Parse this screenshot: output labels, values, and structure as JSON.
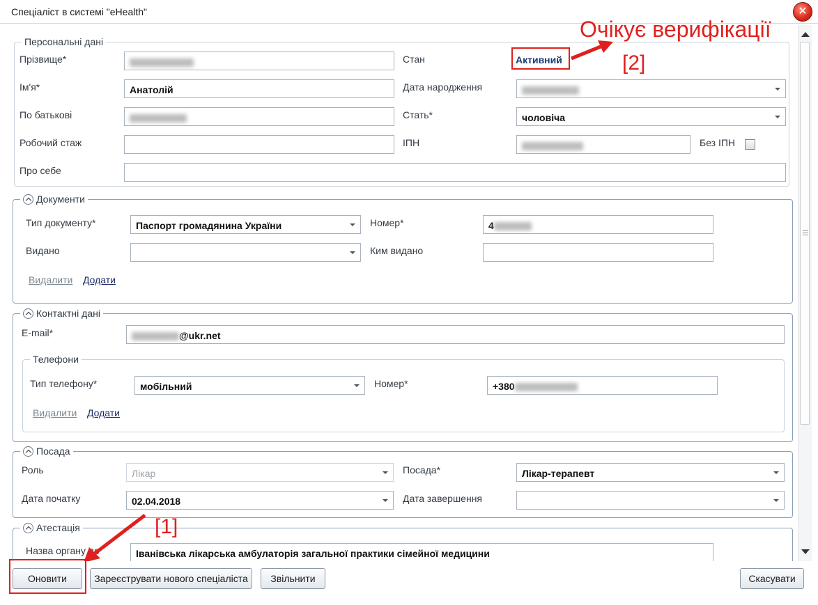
{
  "window": {
    "title": "Спеціаліст в системі \"eHealth\"",
    "close_symbol": "✕"
  },
  "personal": {
    "legend": "Персональні дані",
    "surname_label": "Прізвище*",
    "name_label": "Ім'я*",
    "name_value": "Анатолій",
    "patronymic_label": "По батькові",
    "experience_label": "Робочий стаж",
    "about_label": "Про себе",
    "status_label": "Стан",
    "status_value": "Активний",
    "birthdate_label": "Дата народження",
    "gender_label": "Стать*",
    "gender_value": "чоловіча",
    "ipn_label": "ІПН",
    "no_ipn_label": "Без ІПН"
  },
  "documents": {
    "legend": "Документи",
    "doc_type_label": "Тип документу*",
    "doc_type_value": "Паспорт громадянина України",
    "number_label": "Номер*",
    "number_value": "4",
    "issued_label": "Видано",
    "issued_by_label": "Ким видано",
    "delete_link": "Видалити",
    "add_link": "Додати"
  },
  "contacts": {
    "legend": "Контактні дані",
    "email_label": "E-mail*",
    "email_value": "@ukr.net",
    "phones": {
      "legend": "Телефони",
      "type_label": "Тип телефону*",
      "type_value": "мобільний",
      "number_label": "Номер*",
      "number_value": "+380",
      "delete_link": "Видалити",
      "add_link": "Додати"
    }
  },
  "position": {
    "legend": "Посада",
    "role_label": "Роль",
    "role_value": "Лікар",
    "position_label": "Посада*",
    "position_value": "Лікар-терапевт",
    "start_label": "Дата початку",
    "start_value": "02.04.2018",
    "end_label": "Дата завершення"
  },
  "attestation": {
    "legend": "Атестація",
    "org_label": "Назва органу до",
    "org_value": "Іванівська лікарська амбулаторія загальної практики сімейної медицини"
  },
  "annotations": {
    "awaiting": "Очікує верифікації",
    "marker_2": "[2]",
    "marker_1": "[1]",
    "color": "#e0201e"
  },
  "buttons": {
    "update": "Оновити",
    "register": "Зареєструвати нового спеціаліста",
    "dismiss": "Звільнити",
    "cancel": "Скасувати"
  }
}
